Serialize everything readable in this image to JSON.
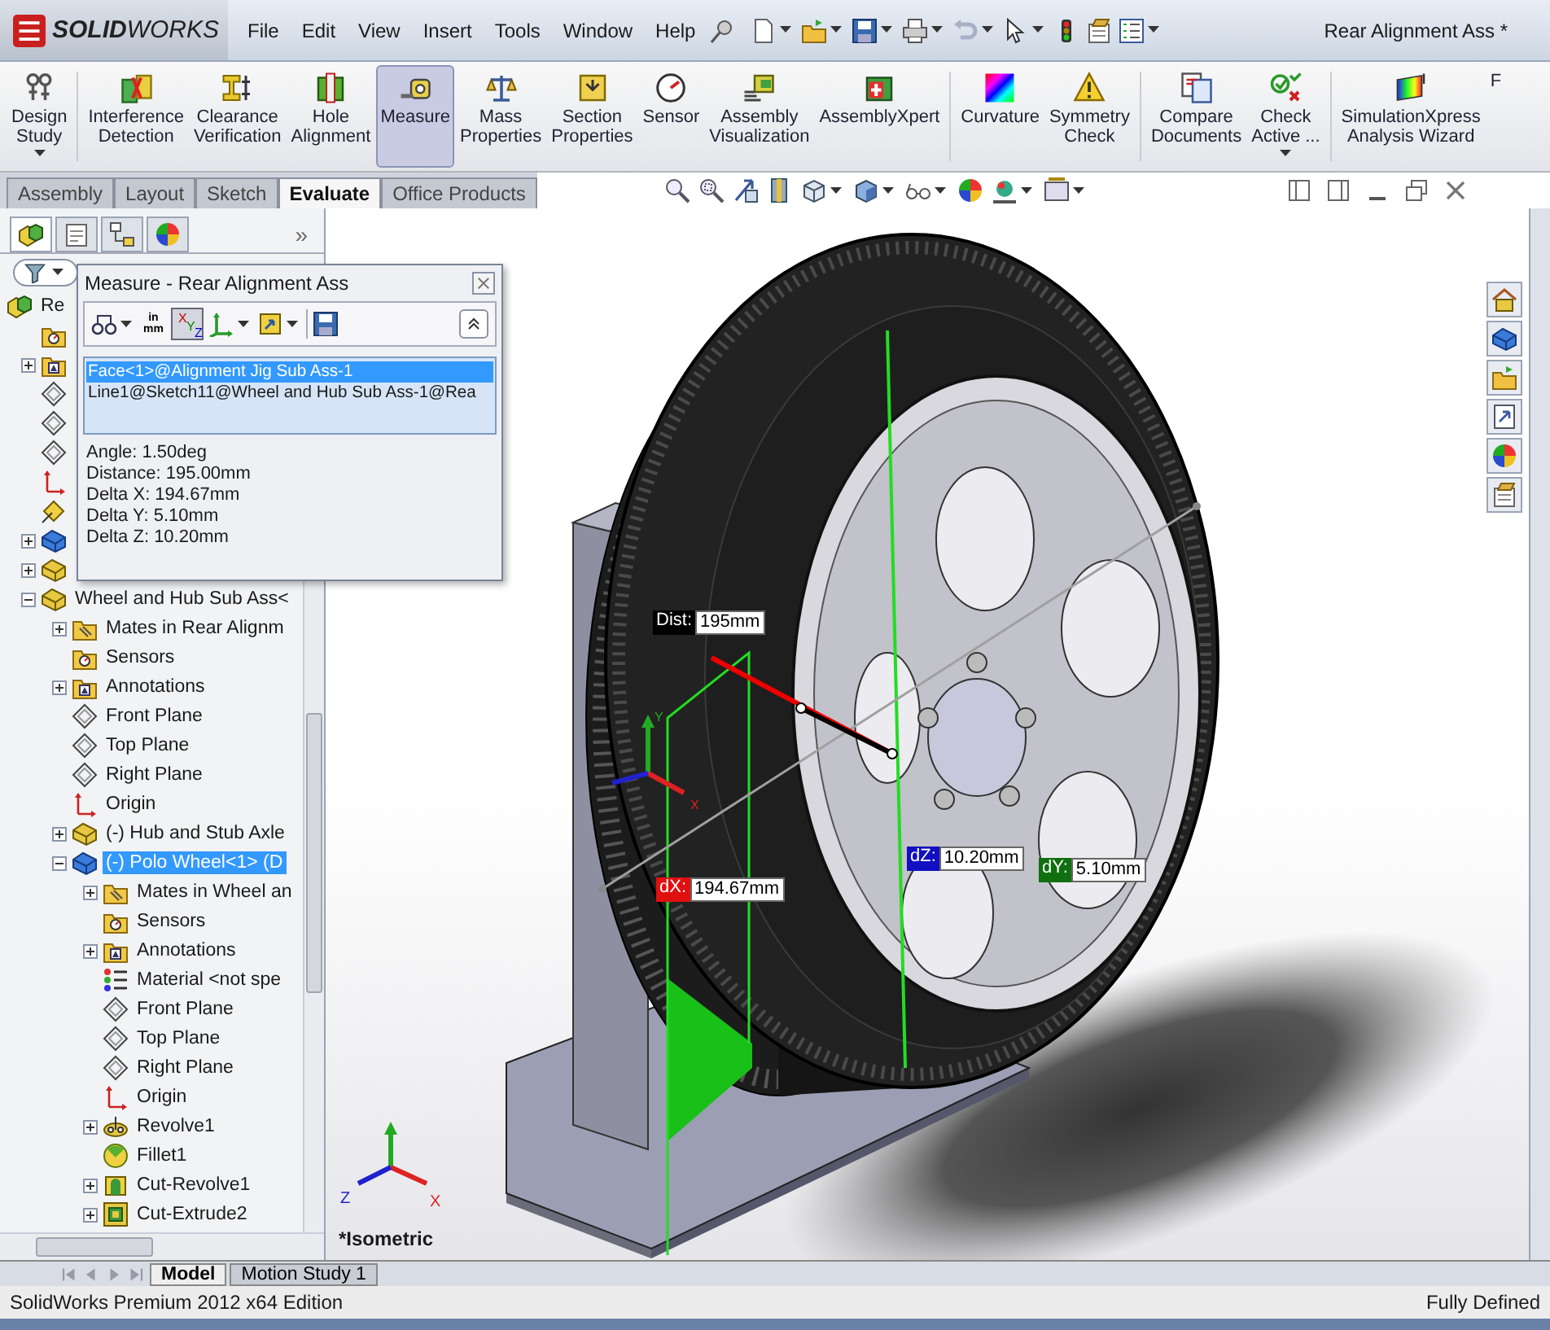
{
  "app_bar": {
    "logo": "**SOLID**WORKS",
    "menu": [
      "File",
      "Edit",
      "View",
      "Insert",
      "Tools",
      "Window",
      "Help"
    ],
    "document_title": "Rear Alignment Ass *"
  },
  "ribbon": [
    {
      "label": "Design\nStudy",
      "selected": false,
      "dropdown": true
    },
    {
      "label": "Interference\nDetection",
      "selected": false,
      "dropdown": false
    },
    {
      "label": "Clearance\nVerification",
      "selected": false,
      "dropdown": false
    },
    {
      "label": "Hole\nAlignment",
      "selected": false,
      "dropdown": false
    },
    {
      "label": "Measure",
      "selected": true,
      "dropdown": false
    },
    {
      "label": "Mass\nProperties",
      "selected": false,
      "dropdown": false
    },
    {
      "label": "Section\nProperties",
      "selected": false,
      "dropdown": false
    },
    {
      "label": "Sensor",
      "selected": false,
      "dropdown": false
    },
    {
      "label": "Assembly\nVisualization",
      "selected": false,
      "dropdown": false
    },
    {
      "label": "AssemblyXpert",
      "selected": false,
      "dropdown": false
    },
    {
      "label": "Curvature",
      "selected": false,
      "dropdown": false
    },
    {
      "label": "Symmetry\nCheck",
      "selected": false,
      "dropdown": false
    },
    {
      "label": "Compare\nDocuments",
      "selected": false,
      "dropdown": false
    },
    {
      "label": "Check\nActive ...",
      "selected": false,
      "dropdown": true
    },
    {
      "label": "SimulationXpress\nAnalysis Wizard",
      "selected": false,
      "dropdown": false
    },
    {
      "label": "F",
      "selected": false,
      "dropdown": false
    }
  ],
  "command_tabs": [
    {
      "label": "Assembly",
      "selected": false
    },
    {
      "label": "Layout",
      "selected": false
    },
    {
      "label": "Sketch",
      "selected": false
    },
    {
      "label": "Evaluate",
      "selected": true
    },
    {
      "label": "Office Products",
      "selected": false
    }
  ],
  "feature_manager": {
    "panel_tabs": [
      {
        "selected": true
      },
      {
        "selected": false
      },
      {
        "selected": false
      },
      {
        "selected": false
      }
    ],
    "more": "»",
    "tree": [
      {
        "label": "Re",
        "kind": "assembly",
        "selected": false,
        "children": [
          {
            "kind": "sensors"
          },
          {
            "kind": "annotations",
            "expanded": false
          },
          {
            "kind": "plane"
          },
          {
            "kind": "plane"
          },
          {
            "kind": "plane"
          },
          {
            "kind": "origin"
          },
          {
            "kind": "reference"
          },
          {
            "kind": "part",
            "expanded": false
          },
          {
            "kind": "subassembly",
            "expanded": false
          },
          {
            "label": "Wheel and Hub Sub Ass<",
            "kind": "subassembly",
            "expanded": true,
            "selected": false,
            "children": [
              {
                "label": "Mates in Rear Alignm",
                "kind": "mates",
                "expanded": false,
                "selected": false
              },
              {
                "label": "Sensors",
                "kind": "sensors",
                "selected": false
              },
              {
                "label": "Annotations",
                "kind": "annotations",
                "expanded": false,
                "selected": false
              },
              {
                "label": "Front Plane",
                "kind": "plane",
                "selected": false
              },
              {
                "label": "Top Plane",
                "kind": "plane",
                "selected": false
              },
              {
                "label": "Right Plane",
                "kind": "plane",
                "selected": false
              },
              {
                "label": "Origin",
                "kind": "origin",
                "selected": false
              },
              {
                "label": "(-) Hub and Stub Axle",
                "kind": "subassembly",
                "expanded": false,
                "selected": false
              },
              {
                "label": "(-) Polo Wheel<1> (D",
                "kind": "part",
                "expanded": true,
                "selected": true,
                "children": [
                  {
                    "label": "Mates in Wheel an",
                    "kind": "mates",
                    "expanded": false,
                    "selected": false
                  },
                  {
                    "label": "Sensors",
                    "kind": "sensors",
                    "selected": false
                  },
                  {
                    "label": "Annotations",
                    "kind": "annotations",
                    "expanded": false,
                    "selected": false
                  },
                  {
                    "label": "Material <not spe",
                    "kind": "material",
                    "selected": false
                  },
                  {
                    "label": "Front Plane",
                    "kind": "plane",
                    "selected": false
                  },
                  {
                    "label": "Top Plane",
                    "kind": "plane",
                    "selected": false
                  },
                  {
                    "label": "Right Plane",
                    "kind": "plane",
                    "selected": false
                  },
                  {
                    "label": "Origin",
                    "kind": "origin",
                    "selected": false
                  },
                  {
                    "label": "Revolve1",
                    "kind": "revolve",
                    "expanded": false,
                    "selected": false
                  },
                  {
                    "label": "Fillet1",
                    "kind": "fillet",
                    "selected": false
                  },
                  {
                    "label": "Cut-Revolve1",
                    "kind": "cut-revolve",
                    "expanded": false,
                    "selected": false
                  },
                  {
                    "label": "Cut-Extrude2",
                    "kind": "cut-extrude",
                    "expanded": false,
                    "selected": false
                  }
                ]
              }
            ]
          }
        ]
      }
    ]
  },
  "measure_dialog": {
    "title": "Measure - Rear Alignment Ass",
    "units": [
      "in",
      "mm"
    ],
    "xyz": {
      "labels": [
        "X",
        "Y",
        "Z"
      ],
      "on": true
    },
    "selections": [
      {
        "text": "Face<1>@Alignment Jig Sub Ass-1",
        "selected": true
      },
      {
        "text": "Line1@Sketch11@Wheel and Hub Sub Ass-1@Rea",
        "selected": false
      }
    ],
    "results": [
      "Angle: 1.50deg",
      "Distance: 195.00mm",
      "Delta X: 194.67mm",
      "Delta Y: 5.10mm",
      "Delta Z: 10.20mm"
    ]
  },
  "viewport": {
    "callouts": [
      {
        "label": "Dist:",
        "value": "195mm",
        "color": "#000000"
      },
      {
        "label": "dX:",
        "value": "194.67mm",
        "color": "#e01010"
      },
      {
        "label": "dZ:",
        "value": "10.20mm",
        "color": "#1010c0"
      },
      {
        "label": "dY:",
        "value": "5.10mm",
        "color": "#107010"
      }
    ],
    "triads": [
      {
        "labels": [
          "Y",
          "X"
        ]
      },
      {
        "labels": [
          "Z",
          "X"
        ]
      }
    ],
    "view_name": "*Isometric"
  },
  "bottom_tabs": [
    {
      "label": "Model",
      "selected": true
    },
    {
      "label": "Motion Study 1",
      "selected": false
    }
  ],
  "status_bar": {
    "product": "SolidWorks Premium 2012 x64 Edition",
    "state": "Fully Defined"
  }
}
